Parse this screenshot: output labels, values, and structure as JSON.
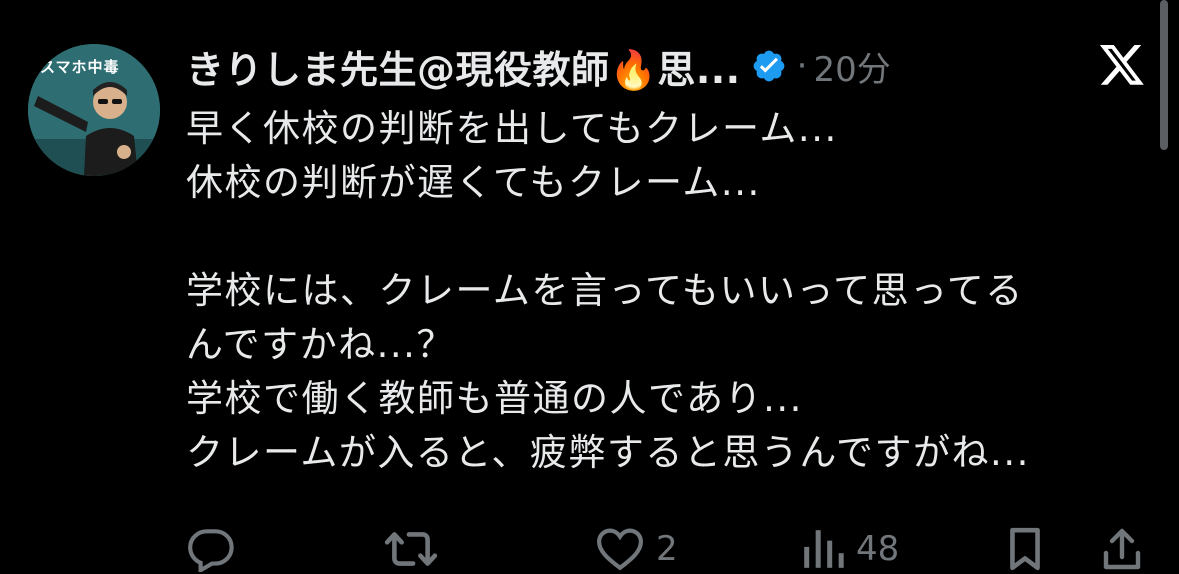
{
  "author": {
    "display_name": "きりしま先生@現役教師🔥思...",
    "avatar_caption": "スマホ中毒",
    "verified": true
  },
  "meta": {
    "separator": "·",
    "time": "20分"
  },
  "tweet": {
    "lines": [
      "早く休校の判断を出してもクレーム...",
      "休校の判断が遅くてもクレーム...",
      "",
      "学校には、クレームを言ってもいいって思ってる",
      "んですかね...？",
      "学校で働く教師も普通の人であり...",
      "クレームが入ると、疲弊すると思うんですがね..."
    ]
  },
  "actions": {
    "reply_count": "",
    "retweet_count": "",
    "like_count": "2",
    "views_count": "48"
  },
  "icons": {
    "brand": "x-logo-icon",
    "verified": "verified-badge-icon",
    "reply": "reply-icon",
    "retweet": "retweet-icon",
    "like": "heart-icon",
    "views": "views-icon",
    "bookmark": "bookmark-icon",
    "share": "share-icon"
  },
  "colors": {
    "background": "#000000",
    "text": "#e7e9ea",
    "muted": "#71767b",
    "verified": "#1d9bf0"
  }
}
